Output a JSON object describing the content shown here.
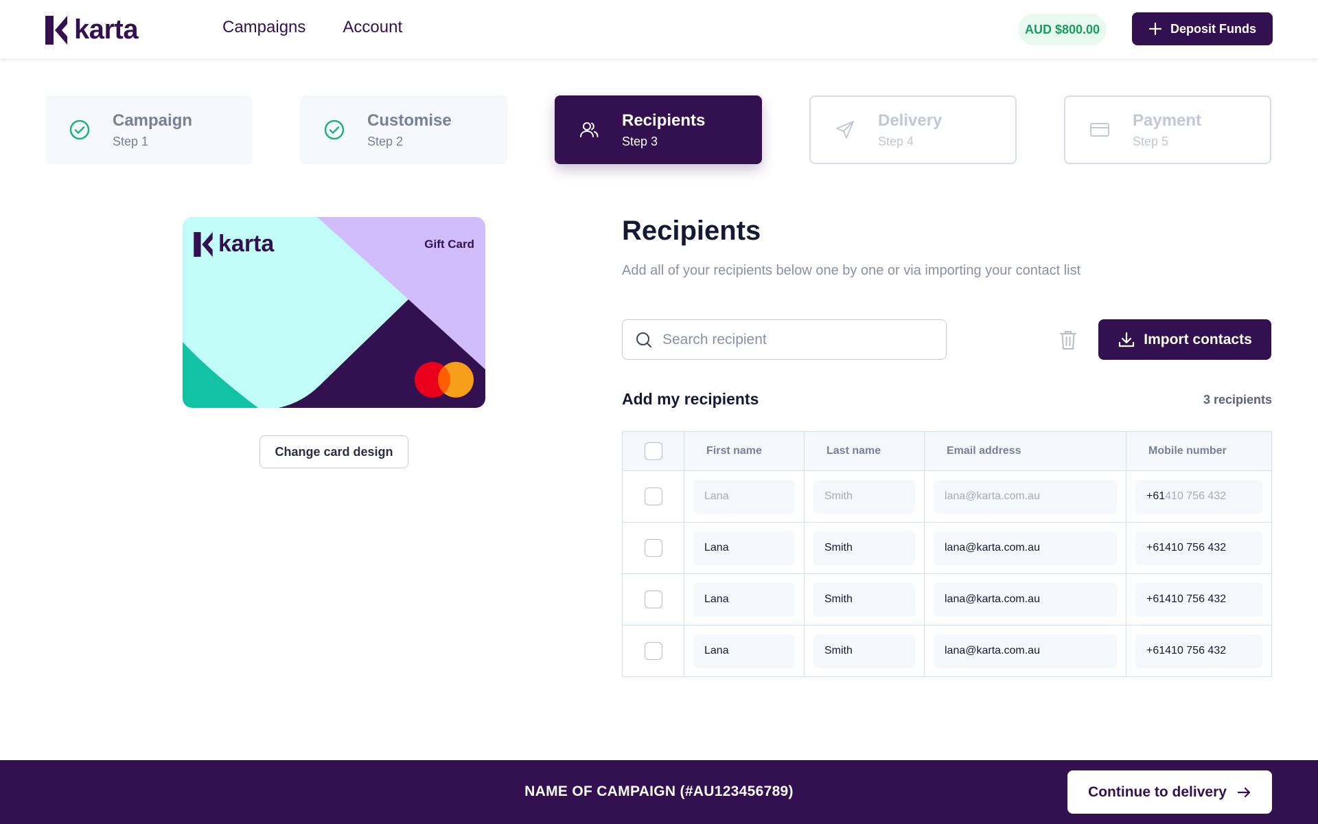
{
  "header": {
    "logo_text": "karta",
    "nav": [
      "Campaigns",
      "Account"
    ],
    "balance": "AUD $800.00",
    "deposit_label": "Deposit Funds"
  },
  "steps": [
    {
      "name": "Campaign",
      "num": "Step 1",
      "state": "done",
      "icon": "check-circle-icon"
    },
    {
      "name": "Customise",
      "num": "Step 2",
      "state": "done",
      "icon": "check-circle-icon"
    },
    {
      "name": "Recipients",
      "num": "Step 3",
      "state": "active",
      "icon": "users-icon"
    },
    {
      "name": "Delivery",
      "num": "Step 4",
      "state": "todo",
      "icon": "send-icon"
    },
    {
      "name": "Payment",
      "num": "Step 5",
      "state": "todo",
      "icon": "credit-card-icon"
    }
  ],
  "card": {
    "logo_text": "karta",
    "label": "Gift Card",
    "change_label": "Change card design"
  },
  "recipients": {
    "title": "Recipients",
    "subtitle": "Add all of your recipients below one by one or via importing your contact list",
    "search_placeholder": "Search recipient",
    "import_label": "Import contacts",
    "add_title": "Add my recipients",
    "count": "3 recipients",
    "columns": [
      "First name",
      "Last name",
      "Email address",
      "Mobile number"
    ],
    "placeholder_row": {
      "first": "Lana",
      "last": "Smith",
      "email": "lana@karta.com.au",
      "mobile_prefix": "+61",
      "mobile": "410 756 432"
    },
    "rows": [
      {
        "first": "Lana",
        "last": "Smith",
        "email": "lana@karta.com.au",
        "mobile": "+61410 756 432"
      },
      {
        "first": "Lana",
        "last": "Smith",
        "email": "lana@karta.com.au",
        "mobile": "+61410 756 432"
      },
      {
        "first": "Lana",
        "last": "Smith",
        "email": "lana@karta.com.au",
        "mobile": "+61410 756 432"
      }
    ]
  },
  "footer": {
    "campaign_name": "NAME OF CAMPAIGN (#AU123456789)",
    "continue_label": "Continue to delivery"
  },
  "colors": {
    "brand": "#33104f",
    "success": "#1a9c5e",
    "card_mint": "#c2fcf8",
    "card_lavender": "#d1bdfa",
    "card_teal": "#12c2a4"
  }
}
